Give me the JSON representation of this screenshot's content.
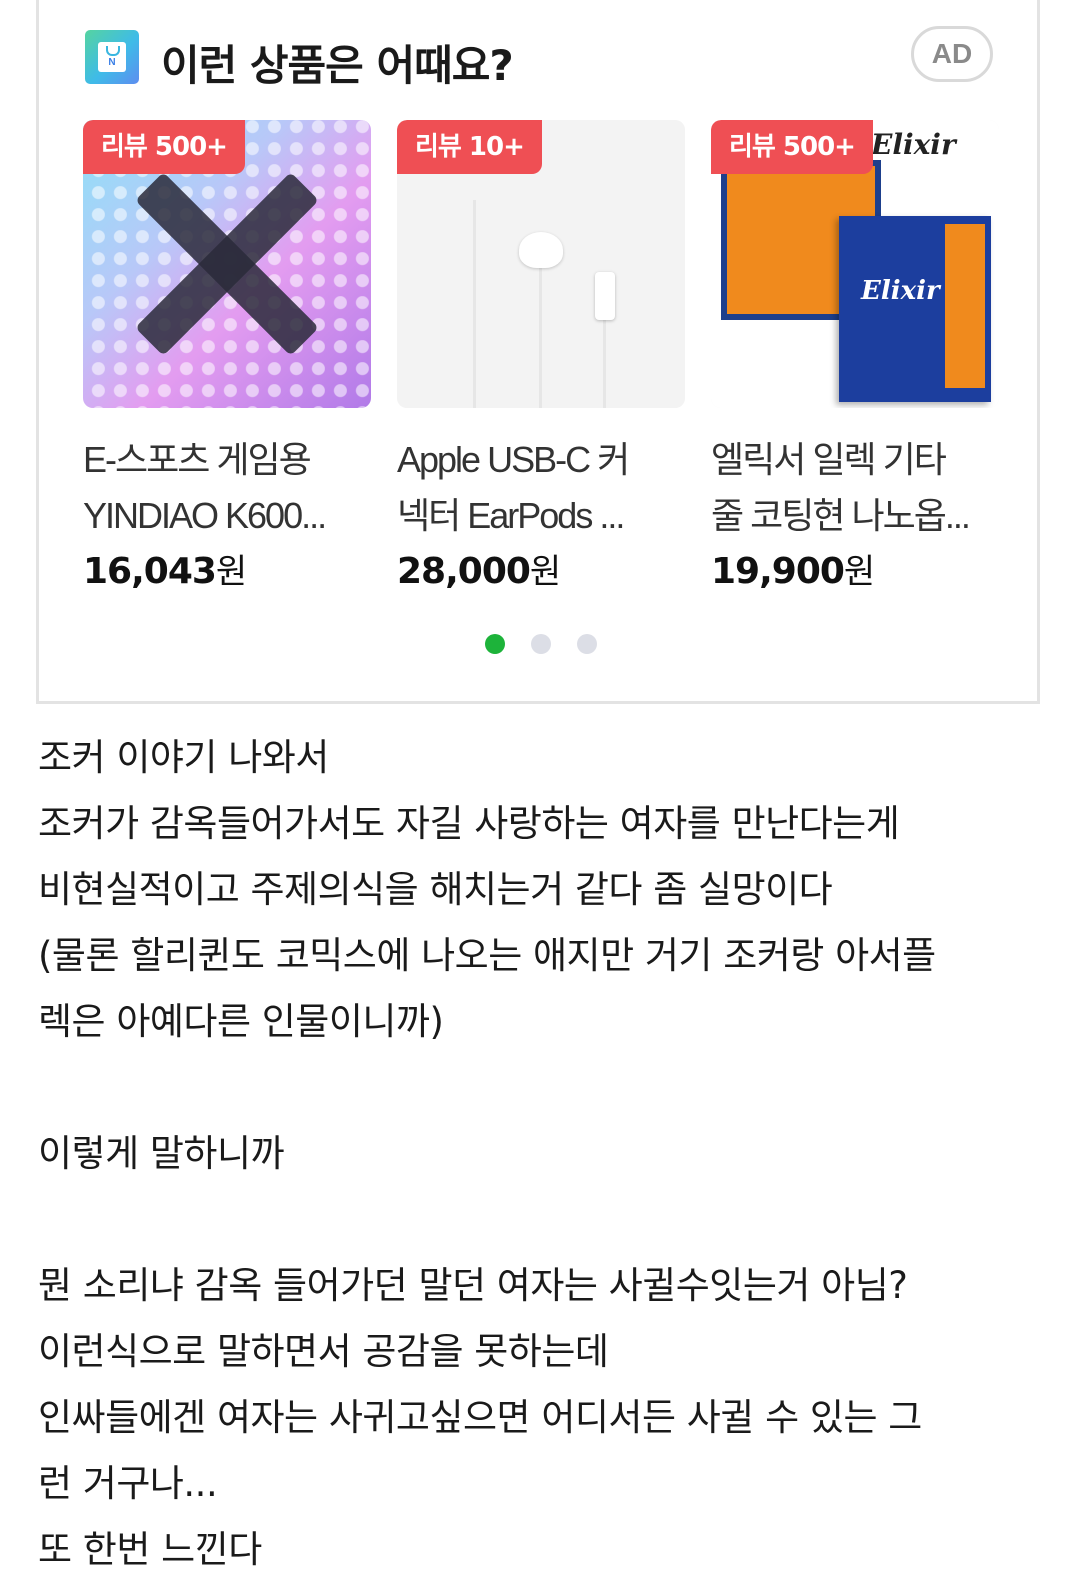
{
  "ad": {
    "title": "이런 상품은 어때요?",
    "badge": "AD",
    "logo_icon": "shopping-bag-icon",
    "products": [
      {
        "review": "리뷰 500+",
        "name_line1": "E-스포츠 게임용",
        "name_line2": "YINDIAO K600...",
        "price": "16,043",
        "currency": "원"
      },
      {
        "review": "리뷰 10+",
        "name_line1": "Apple USB-C 커",
        "name_line2": "넥터 EarPods ...",
        "price": "28,000",
        "currency": "원"
      },
      {
        "review": "리뷰 500+",
        "name_line1": "엘릭서 일렉 기타",
        "name_line2": "줄 코팅현 나노옵...",
        "price": "19,900",
        "currency": "원",
        "image_brand": "Elixir"
      }
    ],
    "carousel_active_page": 1,
    "carousel_pages": 3,
    "colors": {
      "review_badge": "#ef4f54",
      "dot_active": "#1db33a",
      "dot_inactive": "#dcdee6"
    }
  },
  "post": {
    "lines": [
      "조커 이야기 나와서",
      "조커가 감옥들어가서도 자길 사랑하는 여자를 만난다는게",
      "비현실적이고 주제의식을 해치는거 같다 좀 실망이다",
      "(물론 할리퀸도 코믹스에 나오는 애지만 거기 조커랑 아서플",
      "렉은 아예다른 인물이니까)",
      "",
      "이렇게 말하니까",
      "",
      "뭔 소리냐 감옥 들어가던 말던 여자는 사귈수잇는거 아님?",
      "이런식으로 말하면서 공감을 못하는데",
      "인싸들에겐 여자는 사귀고싶으면 어디서든 사귈 수 있는 그",
      "런 거구나...",
      "또 한번 느낀다"
    ]
  }
}
